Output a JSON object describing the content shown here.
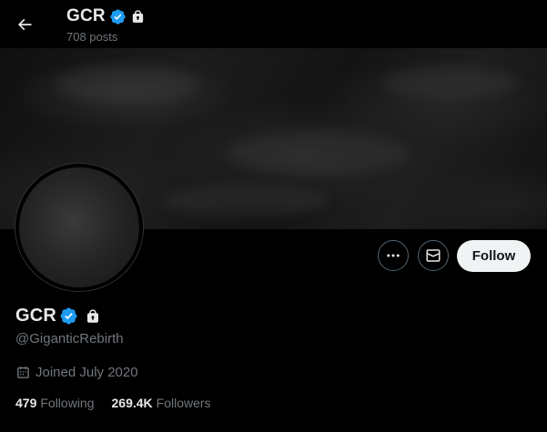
{
  "header": {
    "title": "GCR",
    "subtitle": "708 posts"
  },
  "profile": {
    "display_name": "GCR",
    "handle": "@GiganticRebirth",
    "joined": "Joined July 2020",
    "verified": true,
    "protected": true
  },
  "actions": {
    "follow_label": "Follow"
  },
  "stats": {
    "following_count": "479",
    "following_label": "Following",
    "followers_count": "269.4K",
    "followers_label": "Followers"
  },
  "colors": {
    "background": "#000000",
    "verified_badge": "#1d9bf0",
    "follow_button_bg": "#eff3f4",
    "muted_text": "#71767b"
  },
  "icons": {
    "back": "arrow-left-icon",
    "verified": "verified-badge-icon",
    "protected": "lock-icon",
    "more": "more-horizontal-icon",
    "message": "envelope-icon",
    "calendar": "calendar-icon"
  }
}
